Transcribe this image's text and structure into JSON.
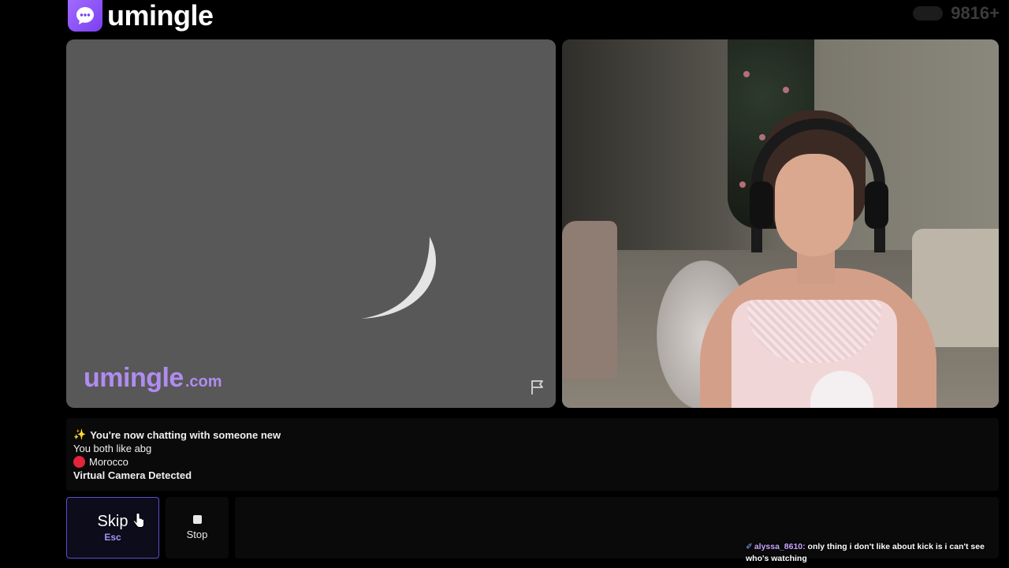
{
  "header": {
    "logo_text": "umingle",
    "online_count": "9816+"
  },
  "stranger_video": {
    "watermark_main": "umingle",
    "watermark_domain": ".com"
  },
  "info": {
    "now_chatting_emoji": "✨",
    "now_chatting": "You're now chatting with someone new",
    "shared_interest": "You both like abg",
    "country": "Morocco",
    "camera_notice": "Virtual Camera Detected"
  },
  "controls": {
    "skip_label": "Skip",
    "skip_key": "Esc",
    "stop_label": "Stop",
    "chat_placeholder": ""
  },
  "overlay_chat": {
    "user": "alyssa_8610:",
    "message": "only thing i don't like about kick is i can't see who's watching"
  },
  "colors": {
    "brand": "#7b3ff0",
    "watermark": "#b08cf0",
    "skip_border": "#5b4fcf"
  }
}
